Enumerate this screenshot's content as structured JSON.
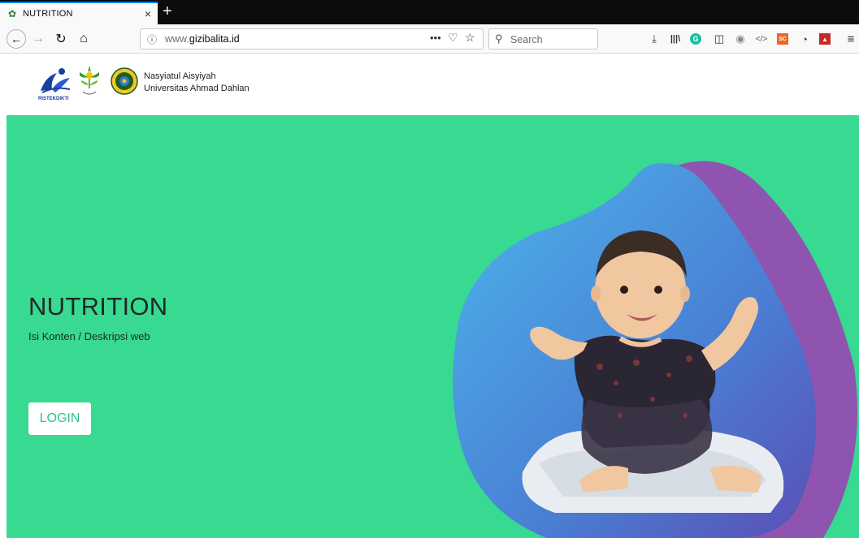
{
  "browser": {
    "tab": {
      "title": "NUTRITION",
      "close": "×"
    },
    "new_tab": "+",
    "url": {
      "prefix": "www.",
      "domain": "gizibalita.id"
    },
    "search": {
      "placeholder": "Search"
    }
  },
  "toolbar_icons": [
    "back-arrow-icon",
    "forward-arrow-icon",
    "reload-icon",
    "home-icon",
    "info-icon",
    "page-actions-icon",
    "pocket-icon",
    "bookmark-star-icon",
    "download-icon",
    "library-icon",
    "grammarly-icon",
    "sidebar-icon",
    "extension-icon",
    "code-icon",
    "sc-extension-icon",
    "privacy-extension-icon",
    "red-extension-icon",
    "hamburger-menu-icon"
  ],
  "extensions": {
    "grammarly": "G",
    "sc": "SC"
  },
  "header": {
    "logo_ristek_text": "RISTEKDIKTI",
    "org_line1": "Nasyiatul Aisyiyah",
    "org_line2": "Universitas Ahmad Dahlan"
  },
  "hero": {
    "title": "NUTRITION",
    "description": "Isi Konten / Deskripsi web",
    "login_label": "LOGIN"
  },
  "colors": {
    "hero_bg": "#38d991",
    "blob_blue": "#4a7fd4",
    "blob_purple": "#8e54b0",
    "button_text": "#2bc48a"
  }
}
